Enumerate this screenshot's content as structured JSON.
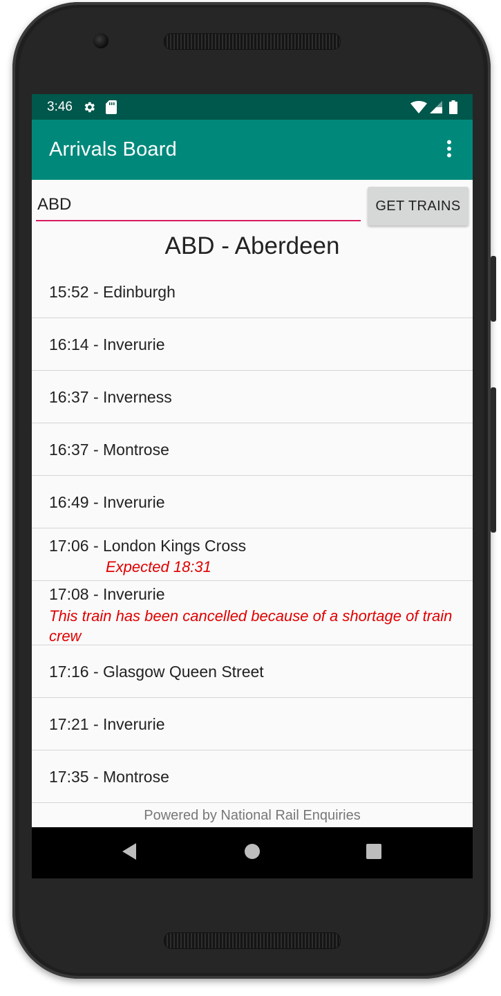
{
  "status_bar": {
    "time": "3:46"
  },
  "app_bar": {
    "title": "Arrivals Board"
  },
  "search": {
    "value": "ABD",
    "button_label": "GET TRAINS"
  },
  "station": {
    "heading": "ABD - Aberdeen"
  },
  "arrivals": [
    {
      "text": "15:52 - Edinburgh"
    },
    {
      "text": "16:14 - Inverurie"
    },
    {
      "text": "16:37 - Inverness"
    },
    {
      "text": "16:37 - Montrose"
    },
    {
      "text": "16:49 - Inverurie"
    },
    {
      "text": "17:06 - London Kings Cross",
      "note": "Expected 18:31"
    },
    {
      "text": "17:08 - Inverurie",
      "note": "This train has been cancelled because of a shortage of train crew"
    },
    {
      "text": "17:16 - Glasgow Queen Street"
    },
    {
      "text": "17:21 - Inverurie"
    },
    {
      "text": "17:35 - Montrose"
    }
  ],
  "footer": {
    "text": "Powered by National Rail Enquiries"
  },
  "colors": {
    "status_bar": "#00574b",
    "app_bar": "#00897b",
    "accent": "#d81b60",
    "alert": "#e00000"
  },
  "icons": {
    "status_left": [
      "settings-icon",
      "sd-card-icon"
    ],
    "status_right": [
      "wifi-icon",
      "signal-icon",
      "battery-icon"
    ],
    "app_bar": "more-vert-icon",
    "nav": [
      "back-icon",
      "home-icon",
      "recents-icon"
    ]
  }
}
